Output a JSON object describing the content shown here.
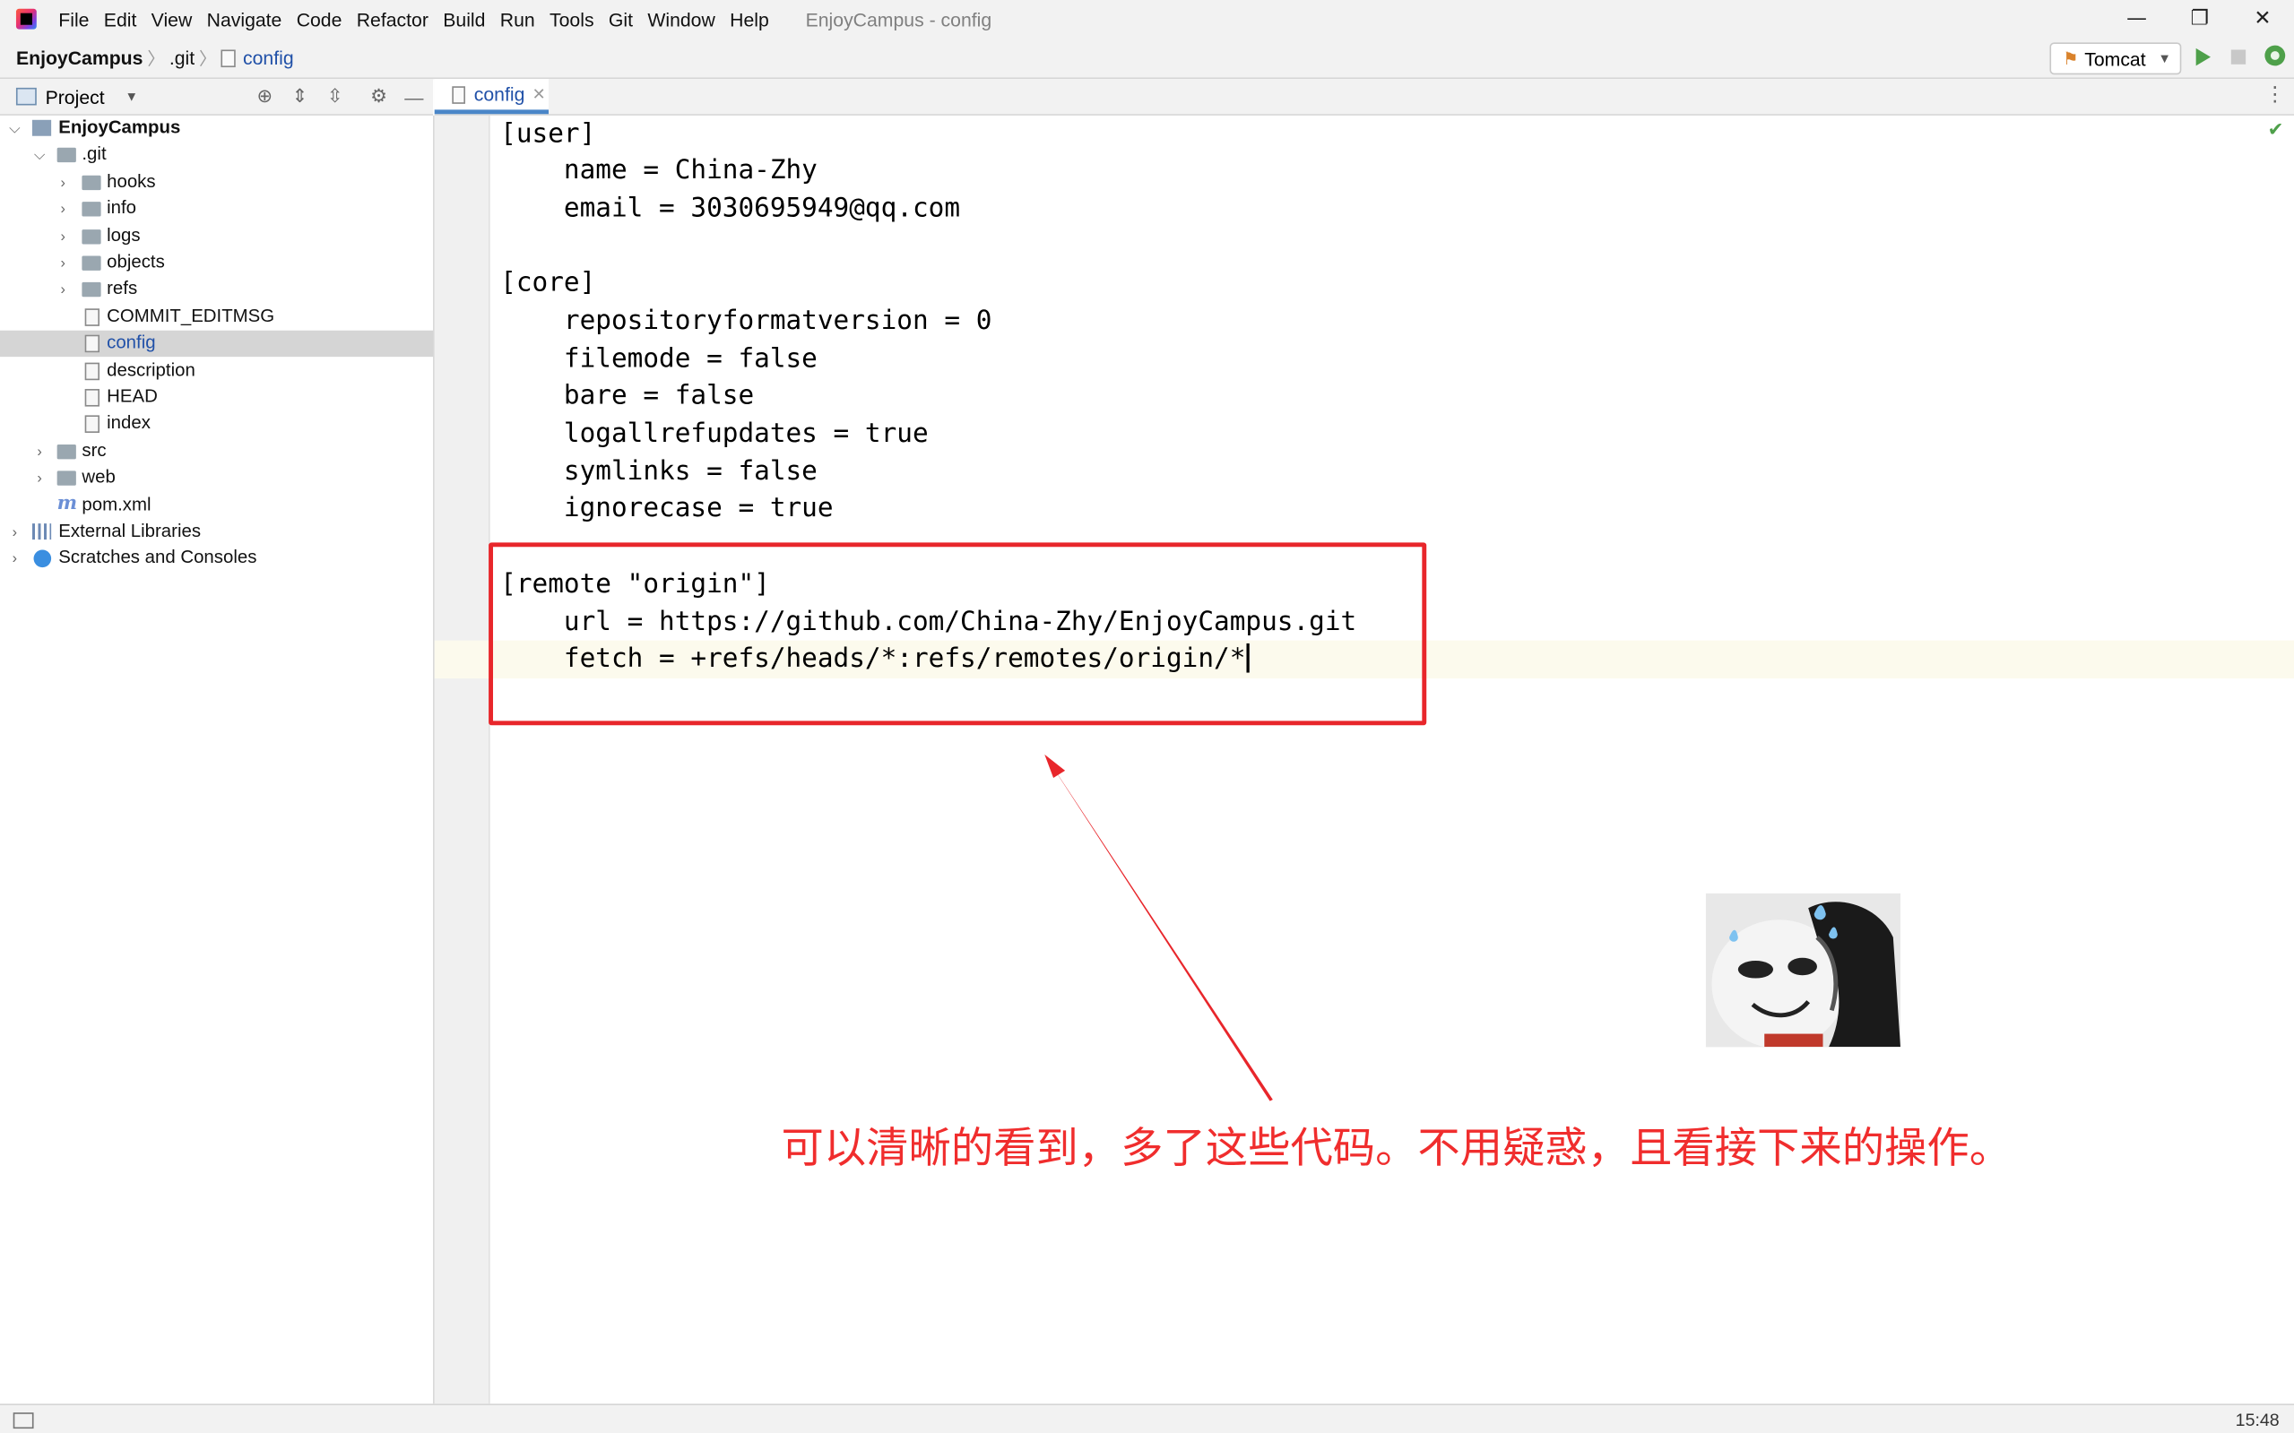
{
  "window": {
    "title": "EnjoyCampus - config",
    "minimize": "—",
    "restore": "❐",
    "close": "✕"
  },
  "menu": [
    "File",
    "Edit",
    "View",
    "Navigate",
    "Code",
    "Refactor",
    "Build",
    "Run",
    "Tools",
    "Git",
    "Window",
    "Help"
  ],
  "breadcrumb": {
    "project": "EnjoyCampus",
    "folder": ".git",
    "file": "config",
    "sep": "〉"
  },
  "run_config": {
    "label": "Tomcat",
    "icon": "tomcat-icon"
  },
  "project_panel": {
    "title": "Project"
  },
  "tab": {
    "label": "config",
    "close": "✕"
  },
  "tree": [
    {
      "label": "EnjoyCampus",
      "icon": "module-icon",
      "expanded": true
    },
    {
      "label": ".git",
      "icon": "folder-icon",
      "expanded": true
    },
    {
      "label": "hooks",
      "icon": "folder-icon"
    },
    {
      "label": "info",
      "icon": "folder-icon"
    },
    {
      "label": "logs",
      "icon": "folder-icon"
    },
    {
      "label": "objects",
      "icon": "folder-icon"
    },
    {
      "label": "refs",
      "icon": "folder-icon"
    },
    {
      "label": "COMMIT_EDITMSG",
      "icon": "file-icon"
    },
    {
      "label": "config",
      "icon": "file-icon",
      "selected": true
    },
    {
      "label": "description",
      "icon": "file-icon"
    },
    {
      "label": "HEAD",
      "icon": "file-icon"
    },
    {
      "label": "index",
      "icon": "unknown-file-icon"
    },
    {
      "label": "src",
      "icon": "folder-icon"
    },
    {
      "label": "web",
      "icon": "web-folder-icon"
    },
    {
      "label": "pom.xml",
      "icon": "maven-icon"
    },
    {
      "label": "External Libraries",
      "icon": "libraries-icon"
    },
    {
      "label": "Scratches and Consoles",
      "icon": "scratches-icon"
    }
  ],
  "editor": {
    "lines": [
      "[user]",
      "    name = China-Zhy",
      "    email = 3030695949@qq.com",
      "",
      "[core]",
      "    repositoryformatversion = 0",
      "    filemode = false",
      "    bare = false",
      "    logallrefupdates = true",
      "    symlinks = false",
      "    ignorecase = true",
      "",
      "[remote \"origin\"]",
      "    url = https://github.com/China-Zhy/EnjoyCampus.git",
      "    fetch = +refs/heads/*:refs/remotes/origin/*"
    ]
  },
  "annotation": {
    "text": "可以清晰的看到，多了这些代码。不用疑惑，且看接下来的操作。",
    "color": "#f02d2d"
  },
  "status": {
    "time": "15:48"
  },
  "colors": {
    "accent": "#4a86c8",
    "selection": "#d5d5d5",
    "highlight_box": "#e8262b",
    "run_green": "#4ea04a"
  }
}
